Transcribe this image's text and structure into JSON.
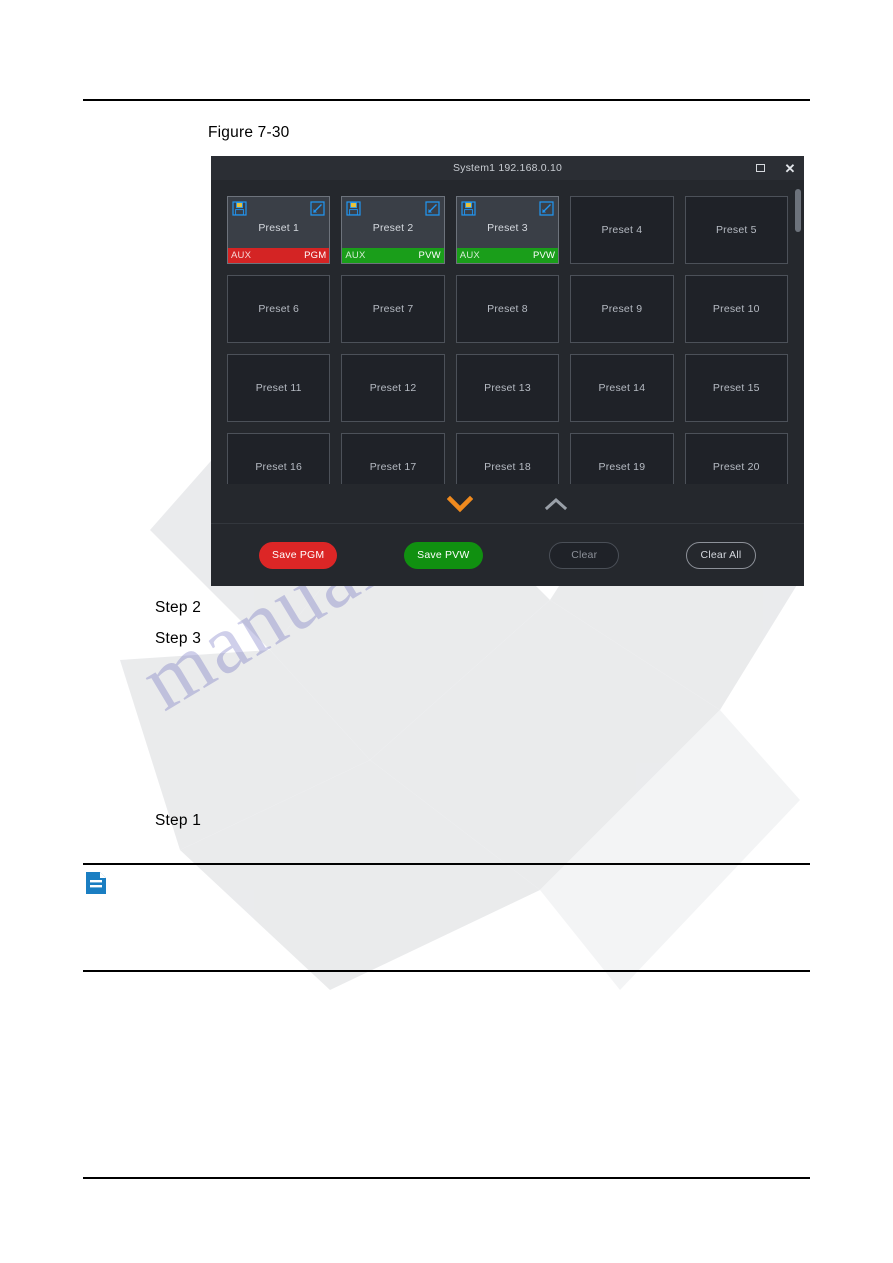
{
  "document": {
    "figure_caption": "Figure 7-30",
    "steps": [
      {
        "id": "step-2",
        "label": "Step 2"
      },
      {
        "id": "step-3",
        "label": "Step 3"
      },
      {
        "id": "step-1",
        "label": "Step 1"
      }
    ],
    "note_icon": "note-document-icon",
    "watermark_text": "manualshive.com"
  },
  "window": {
    "title": "System1 192.168.0.10",
    "maximize_icon": "maximize-icon",
    "close_icon": "close-icon"
  },
  "presets": [
    {
      "name": "Preset 1",
      "saved": true,
      "status": "PGM",
      "aux": "AUX",
      "save_icon": "save-floppy-icon",
      "edit_icon": "edit-pencil-icon"
    },
    {
      "name": "Preset 2",
      "saved": true,
      "status": "PVW",
      "aux": "AUX",
      "save_icon": "save-floppy-icon",
      "edit_icon": "edit-pencil-icon"
    },
    {
      "name": "Preset 3",
      "saved": true,
      "status": "PVW",
      "aux": "AUX",
      "save_icon": "save-floppy-icon",
      "edit_icon": "edit-pencil-icon"
    },
    {
      "name": "Preset 4",
      "saved": false
    },
    {
      "name": "Preset 5",
      "saved": false
    },
    {
      "name": "Preset 6",
      "saved": false
    },
    {
      "name": "Preset 7",
      "saved": false
    },
    {
      "name": "Preset 8",
      "saved": false
    },
    {
      "name": "Preset 9",
      "saved": false
    },
    {
      "name": "Preset 10",
      "saved": false
    },
    {
      "name": "Preset 11",
      "saved": false
    },
    {
      "name": "Preset 12",
      "saved": false
    },
    {
      "name": "Preset 13",
      "saved": false
    },
    {
      "name": "Preset 14",
      "saved": false
    },
    {
      "name": "Preset 15",
      "saved": false
    },
    {
      "name": "Preset 16",
      "saved": false
    },
    {
      "name": "Preset 17",
      "saved": false
    },
    {
      "name": "Preset 18",
      "saved": false
    },
    {
      "name": "Preset 19",
      "saved": false
    },
    {
      "name": "Preset 20",
      "saved": false
    }
  ],
  "pager": {
    "down_icon": "chevron-down-icon",
    "up_icon": "chevron-up-icon"
  },
  "footer": {
    "save_pgm_label": "Save PGM",
    "save_pvw_label": "Save PVW",
    "clear_label": "Clear",
    "clear_all_label": "Clear All"
  },
  "colors": {
    "pgm_red": "#d42424",
    "pvw_green": "#1a9e1a",
    "save_pgm_red": "#dc2626",
    "save_pvw_green": "#109010",
    "window_bg": "#25282d",
    "card_bg": "#1f2228",
    "card_saved_bg": "#3a3f47",
    "icon_blue": "#2196f3",
    "chevron_orange": "#f08a1e",
    "chevron_gray": "#8d9199",
    "note_icon_blue": "#1a7ec2"
  }
}
